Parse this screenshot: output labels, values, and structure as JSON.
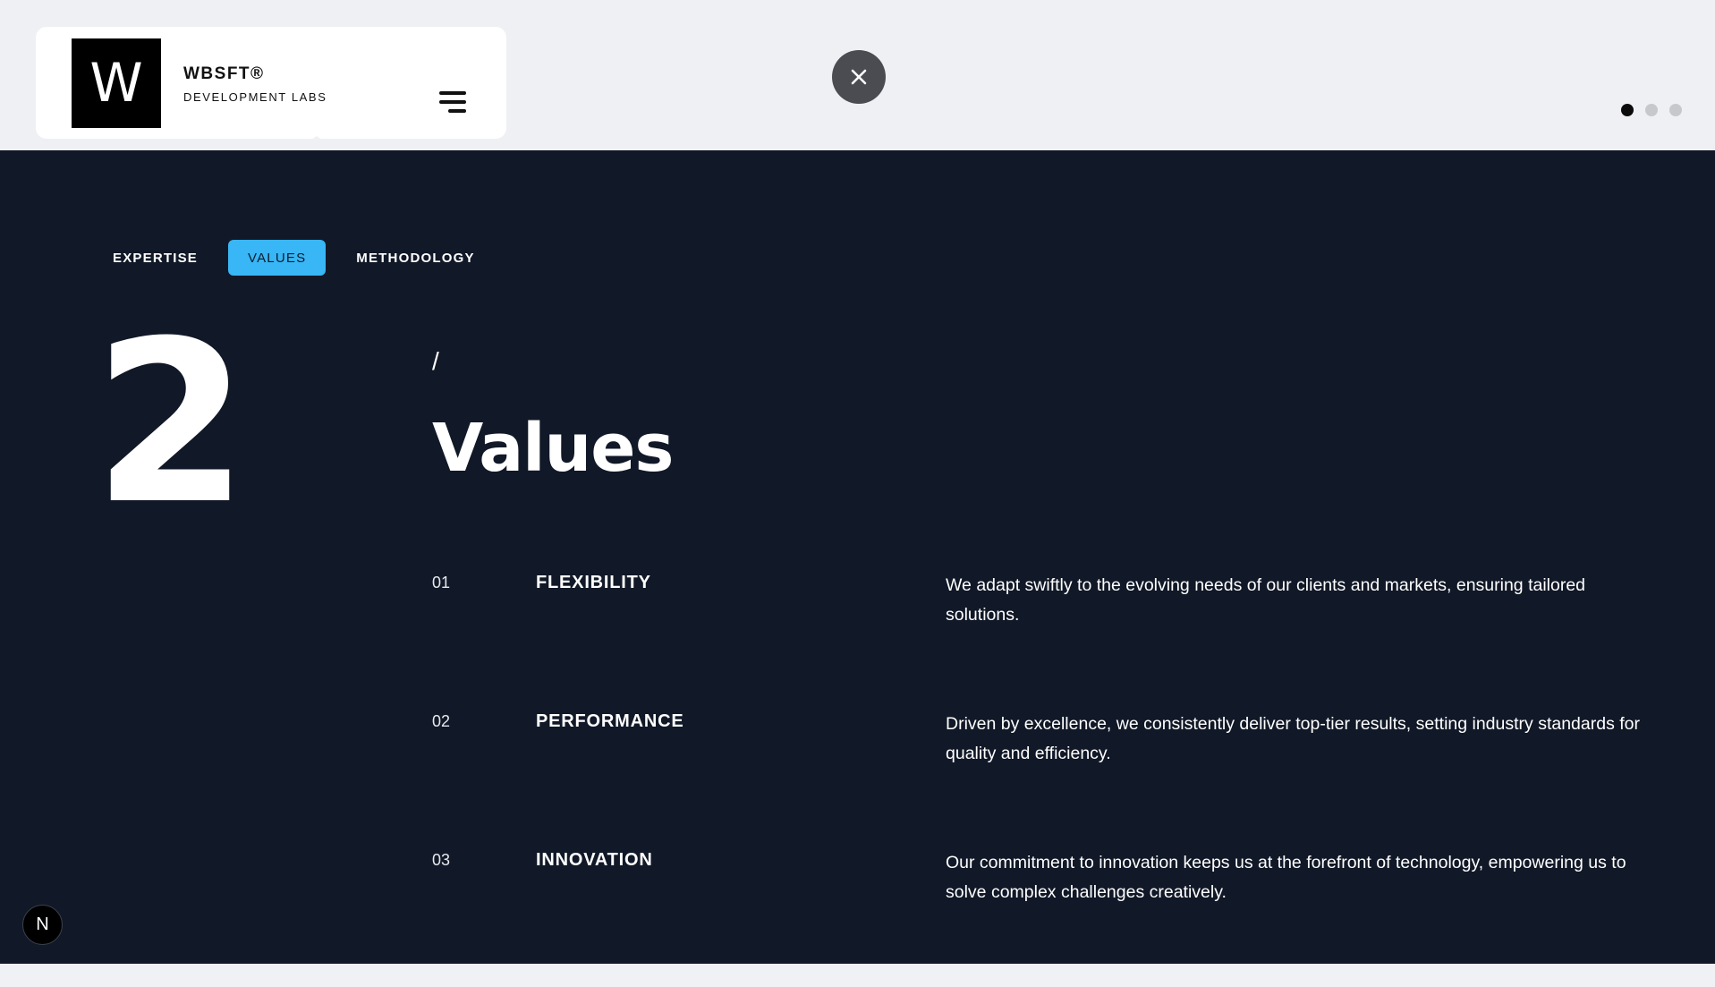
{
  "header": {
    "logo_letter": "W",
    "brand_name": "WBSFT®",
    "brand_subtitle": "DEVELOPMENT LABS",
    "menu_icon": "hamburger-icon",
    "close_icon": "close-icon",
    "pagination": {
      "count": 3,
      "active_index": 0
    }
  },
  "tabs": [
    {
      "label": "EXPERTISE",
      "active": false
    },
    {
      "label": "VALUES",
      "active": true
    },
    {
      "label": "METHODOLOGY",
      "active": false
    }
  ],
  "section": {
    "number": "2",
    "slash": "/",
    "title": "Values"
  },
  "values": [
    {
      "num": "01",
      "name": "FLEXIBILITY",
      "description": "We adapt swiftly to the evolving needs of our clients and markets, ensuring tailored solutions."
    },
    {
      "num": "02",
      "name": "PERFORMANCE",
      "description": "Driven by excellence, we consistently deliver top-tier results, setting industry standards for quality and efficiency."
    },
    {
      "num": "03",
      "name": "INNOVATION",
      "description": "Our commitment to innovation keeps us at the forefront of technology, empowering us to solve complex challenges creatively."
    }
  ],
  "badge": {
    "label": "N"
  },
  "colors": {
    "accent": "#38b6f5",
    "main_bg": "#111827",
    "top_bg": "#eff0f4"
  }
}
